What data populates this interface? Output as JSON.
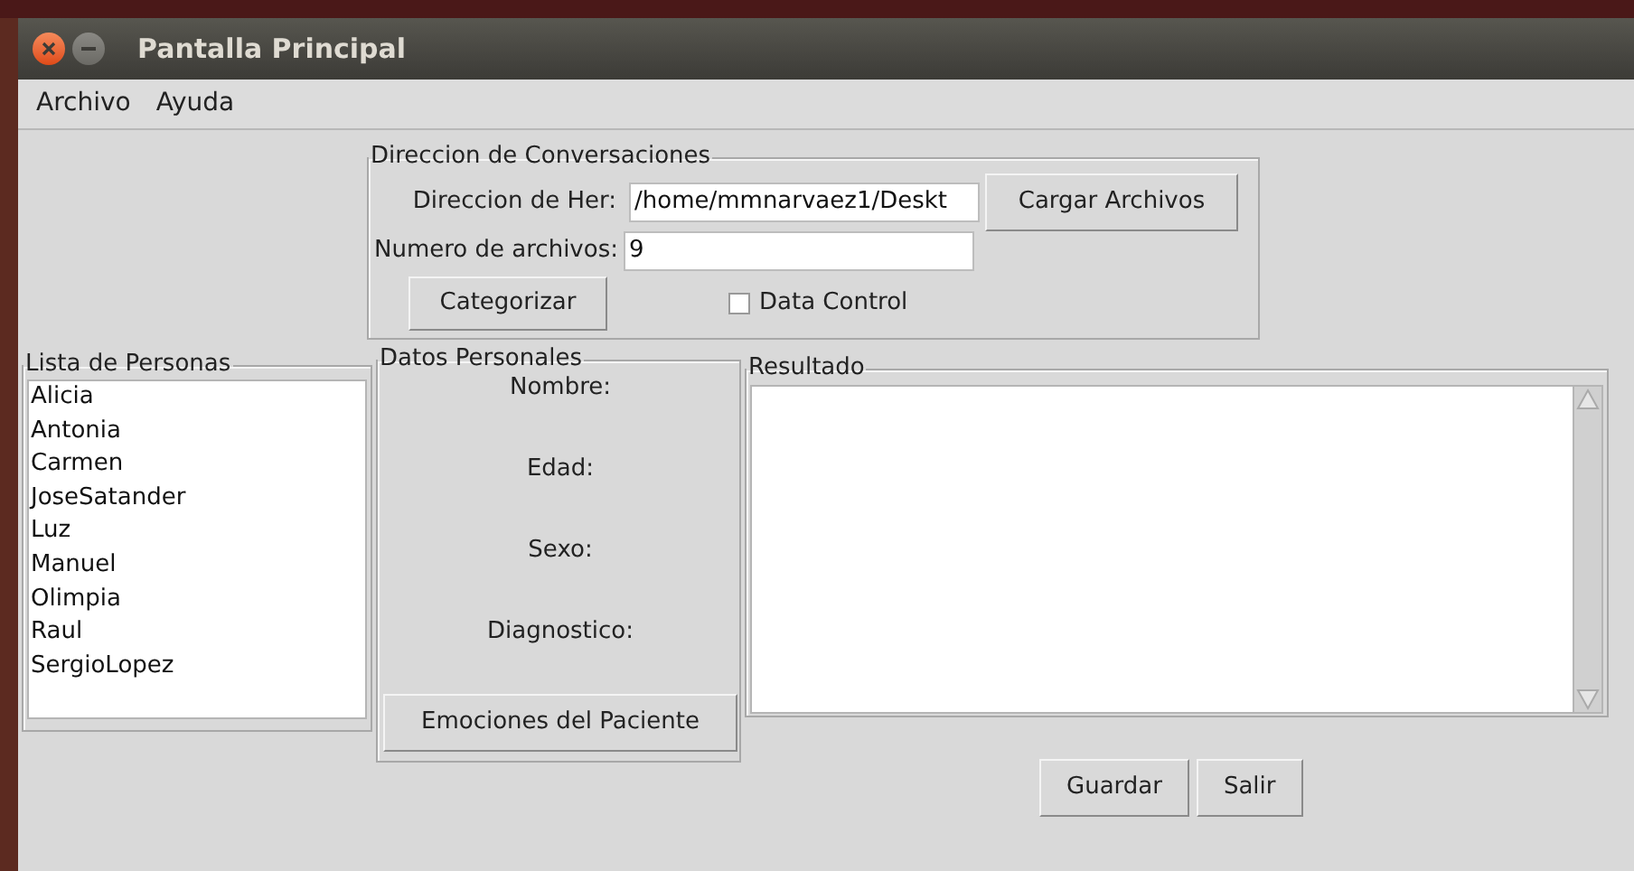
{
  "window": {
    "title": "Pantalla Principal"
  },
  "menu": [
    "Archivo",
    "Ayuda"
  ],
  "conversaciones": {
    "title": "Direccion de Conversaciones",
    "dir_label": "Direccion de Her:",
    "dir_value": "/home/mmnarvaez1/Deskt",
    "load_button": "Cargar Archivos",
    "count_label": "Numero de archivos:",
    "count_value": "9",
    "categorize_button": "Categorizar",
    "data_control": {
      "label": "Data Control",
      "checked": false
    }
  },
  "personas": {
    "title": "Lista de Personas",
    "items": [
      {
        "name": "Alicia",
        "selected": false
      },
      {
        "name": "Antonia",
        "selected": false
      },
      {
        "name": "Carmen",
        "selected": false
      },
      {
        "name": "JoseSatander",
        "selected": false
      },
      {
        "name": "Luz",
        "selected": false
      },
      {
        "name": "Manuel",
        "selected": false
      },
      {
        "name": "Olimpia",
        "selected": false
      },
      {
        "name": "Raul",
        "selected": false
      },
      {
        "name": "SergioLopez",
        "selected": false
      }
    ]
  },
  "datos": {
    "title": "Datos Personales",
    "fields": [
      "Nombre:",
      "Edad:",
      "Sexo:",
      "Diagnostico:"
    ],
    "button": "Emociones del Paciente"
  },
  "resultado": {
    "title": "Resultado"
  },
  "buttons": [
    "Guardar",
    "Salir"
  ]
}
